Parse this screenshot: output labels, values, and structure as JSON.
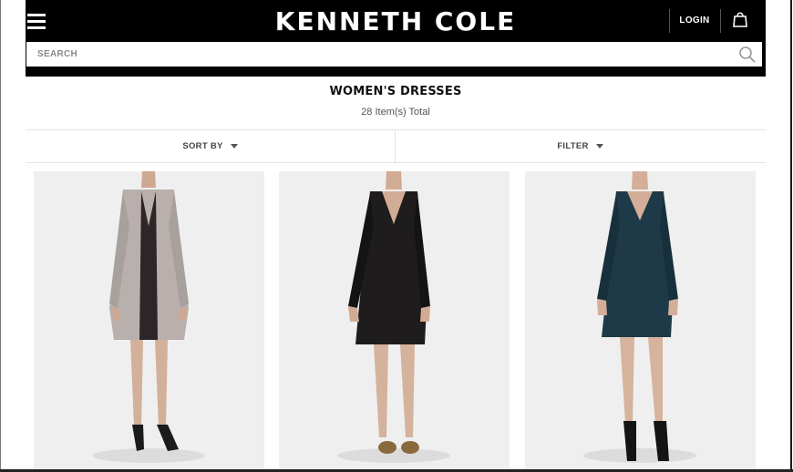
{
  "header": {
    "logo": "KENNETH COLE",
    "login_label": "LOGIN"
  },
  "search": {
    "placeholder": "SEARCH"
  },
  "page": {
    "title": "WOMEN'S DRESSES",
    "item_count": "28 Item(s) Total"
  },
  "controls": {
    "sort_label": "SORT BY",
    "filter_label": "FILTER"
  },
  "products": [
    {
      "dress": "printed long-sleeve v-neck dress",
      "dress_color": "#b9b0ad",
      "print_color": "#2d2628",
      "shoes": "black strappy sandals"
    },
    {
      "dress": "black long-sleeve v-neck dress",
      "dress_color": "#1e1c1d",
      "shoes": "leopard print flats"
    },
    {
      "dress": "teal long-sleeve v-neck dress",
      "dress_color": "#1e3a48",
      "shoes": "black ankle boots"
    }
  ],
  "colors": {
    "header_bg": "#000000",
    "text_primary": "#111111",
    "tile_bg": "#efefef"
  }
}
